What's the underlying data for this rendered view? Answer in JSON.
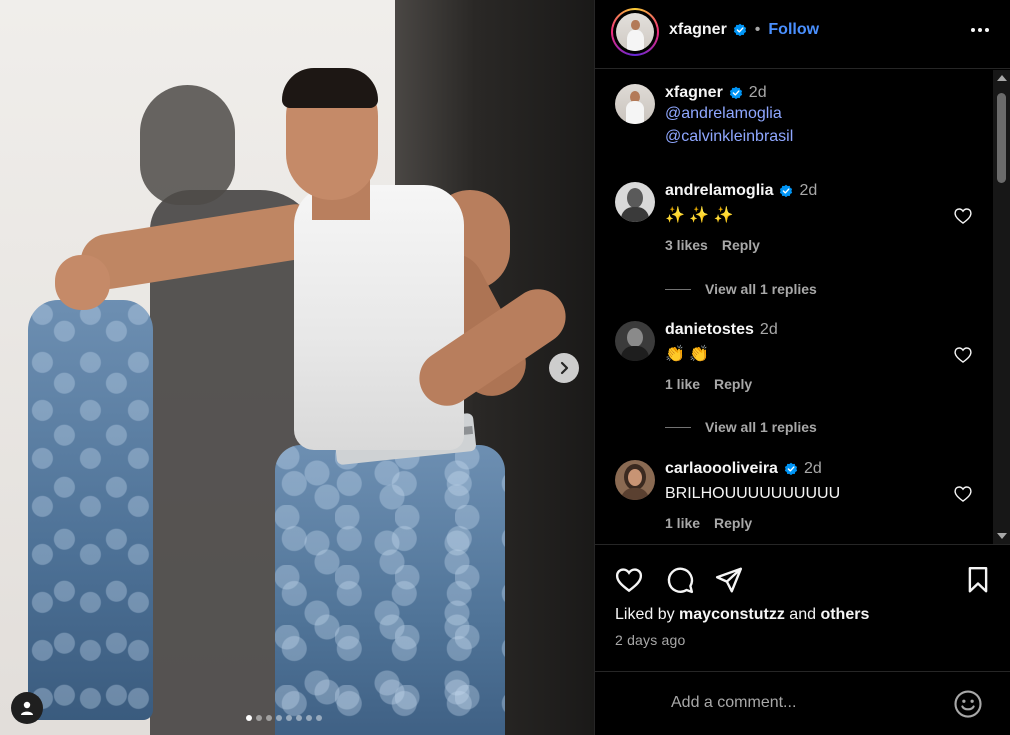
{
  "post": {
    "username": "xfagner",
    "follow_sep": "•",
    "follow_label": "Follow",
    "caption_time": "2d",
    "caption_mentions": [
      "@andrelamoglia",
      "@calvinkleinbrasil"
    ]
  },
  "carousel": {
    "slide_count": 8,
    "active_index": 0
  },
  "comments": [
    {
      "user": "andrelamoglia",
      "verified": true,
      "time": "2d",
      "text": "✨ ✨ ✨",
      "likes": "3 likes",
      "reply": "Reply",
      "view_replies": "View all 1 replies"
    },
    {
      "user": "danietostes",
      "verified": false,
      "time": "2d",
      "text": "👏 👏",
      "likes": "1 like",
      "reply": "Reply",
      "view_replies": "View all 1 replies"
    },
    {
      "user": "carlaoooliveira",
      "verified": true,
      "time": "2d",
      "text": "BRILHOUUUUUUUUUU",
      "likes": "1 like",
      "reply": "Reply"
    }
  ],
  "footer": {
    "liked_prefix": "Liked by",
    "liked_user": "mayconstutzz",
    "liked_and": "and",
    "liked_others": "others",
    "post_age": "2 days ago",
    "comment_placeholder": "Add a comment..."
  },
  "icons": {
    "verified": "verified-badge-icon",
    "heart": "heart-icon",
    "comment": "comment-icon",
    "share": "share-icon",
    "save": "bookmark-icon",
    "emoji": "emoji-icon",
    "more": "more-options-icon",
    "next": "chevron-right-icon",
    "user_tag": "user-tag-icon"
  },
  "colors": {
    "verified_blue": "#0095f6",
    "link_blue": "#4a90ff",
    "mention_blue": "#8fa7ff",
    "background": "#000000"
  }
}
